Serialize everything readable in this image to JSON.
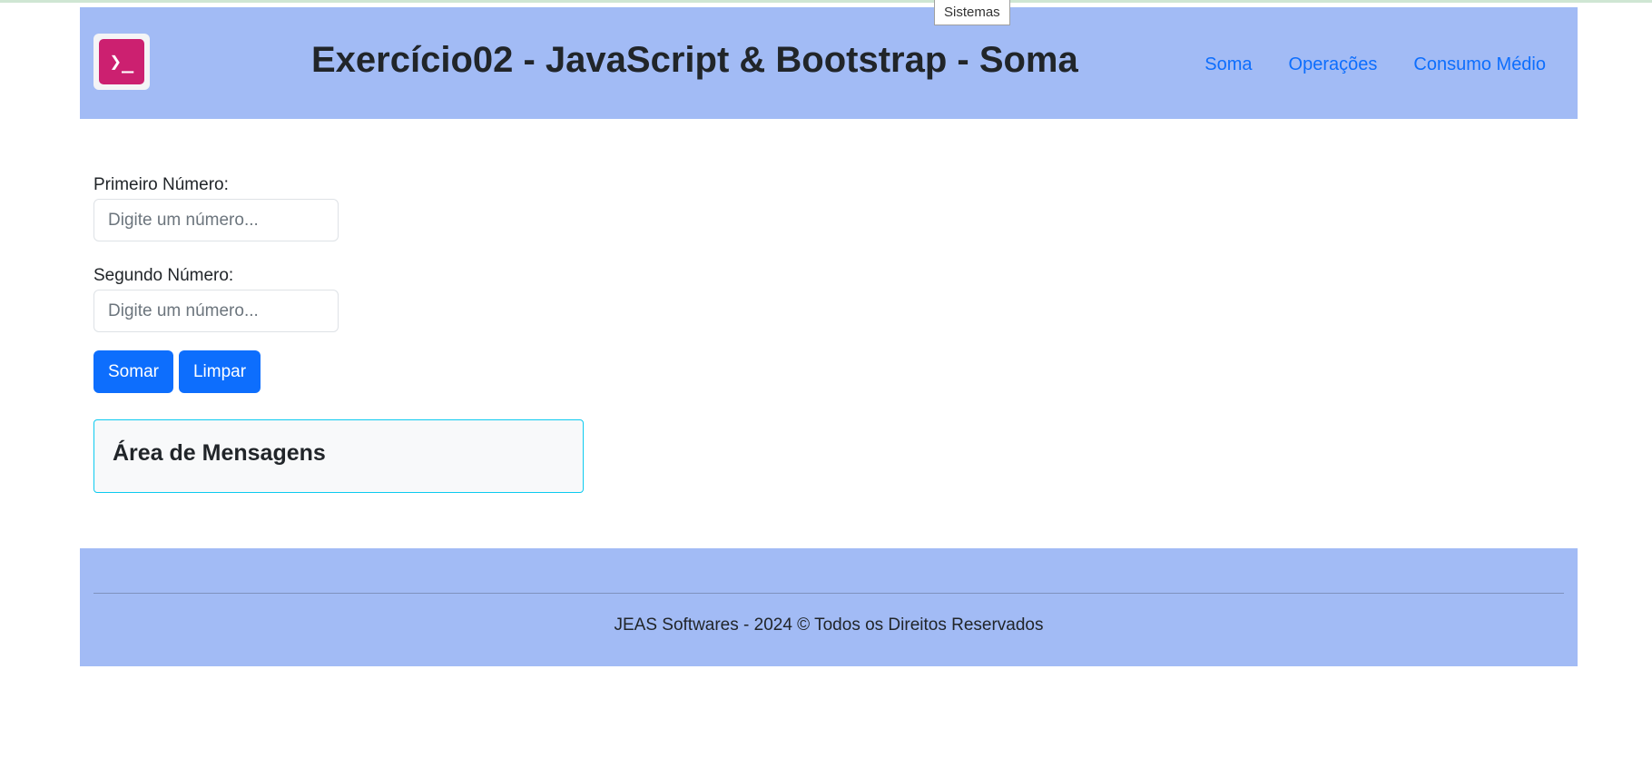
{
  "tooltip": "Sistemas",
  "header": {
    "logo_glyph": "❯_",
    "title": "Exercício02 - JavaScript & Bootstrap - Soma",
    "nav": [
      {
        "label": "Soma"
      },
      {
        "label": "Operações"
      },
      {
        "label": "Consumo Médio"
      }
    ]
  },
  "form": {
    "first": {
      "label": "Primeiro Número:",
      "placeholder": "Digite um número...",
      "value": ""
    },
    "second": {
      "label": "Segundo Número:",
      "placeholder": "Digite um número...",
      "value": ""
    },
    "sum_button": "Somar",
    "clear_button": "Limpar"
  },
  "messages": {
    "title": "Área de Mensagens"
  },
  "footer": {
    "copyright": "JEAS Softwares - 2024 © Todos os Direitos Reservados"
  },
  "colors": {
    "header_bg": "#a2bbf5",
    "primary": "#0d6efd",
    "logo_bg": "#cc2070",
    "info_border": "#0dcaf0"
  },
  "icons": {
    "logo": "terminal-prompt-icon"
  }
}
